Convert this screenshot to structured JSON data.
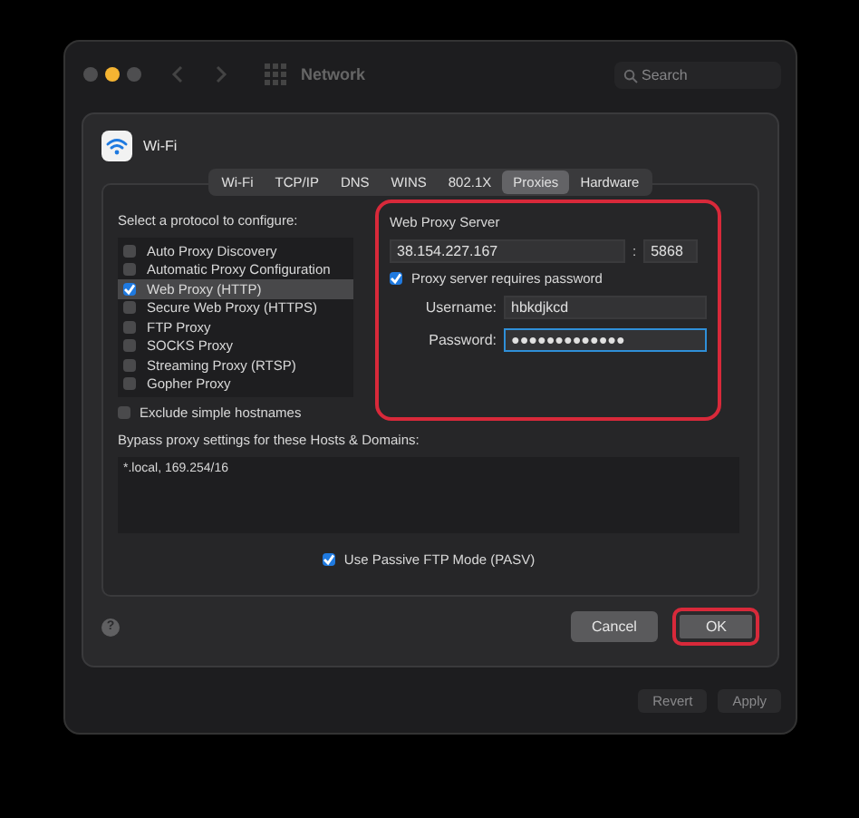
{
  "window": {
    "title": "Network",
    "search": {
      "placeholder": "Search"
    }
  },
  "sheet": {
    "service": "Wi-Fi",
    "tabs": [
      {
        "label": "Wi-Fi",
        "selected": false
      },
      {
        "label": "TCP/IP",
        "selected": false
      },
      {
        "label": "DNS",
        "selected": false
      },
      {
        "label": "WINS",
        "selected": false
      },
      {
        "label": "802.1X",
        "selected": false
      },
      {
        "label": "Proxies",
        "selected": true
      },
      {
        "label": "Hardware",
        "selected": false
      }
    ],
    "protocol_prompt": "Select a protocol to configure:",
    "protocols": [
      {
        "label": "Auto Proxy Discovery",
        "checked": false,
        "selected": false
      },
      {
        "label": "Automatic Proxy Configuration",
        "checked": false,
        "selected": false
      },
      {
        "label": "Web Proxy (HTTP)",
        "checked": true,
        "selected": true
      },
      {
        "label": "Secure Web Proxy (HTTPS)",
        "checked": false,
        "selected": false
      },
      {
        "label": "FTP Proxy",
        "checked": false,
        "selected": false
      },
      {
        "label": "SOCKS Proxy",
        "checked": false,
        "selected": false
      },
      {
        "label": "Streaming Proxy (RTSP)",
        "checked": false,
        "selected": false
      },
      {
        "label": "Gopher Proxy",
        "checked": false,
        "selected": false
      }
    ],
    "exclude_simple_hostnames": {
      "label": "Exclude simple hostnames",
      "checked": false
    },
    "proxy_server": {
      "title": "Web Proxy Server",
      "highlighted": true,
      "host": "38.154.227.167",
      "separator": ":",
      "port": "5868",
      "requires_password": {
        "label": "Proxy server requires password",
        "checked": true
      },
      "username": {
        "label": "Username:",
        "value": "hbkdjkcd"
      },
      "password": {
        "label": "Password:",
        "value": "●●●●●●●●●●●●●",
        "focused": true
      }
    },
    "bypass": {
      "label": "Bypass proxy settings for these Hosts & Domains:",
      "value": "*.local, 169.254/16"
    },
    "passive_ftp": {
      "label": "Use Passive FTP Mode (PASV)",
      "checked": true
    },
    "help": "?",
    "buttons": [
      {
        "label": "Cancel",
        "kind": "secondary",
        "highlighted": false
      },
      {
        "label": "OK",
        "kind": "primary",
        "highlighted": true
      }
    ]
  },
  "footer_buttons": [
    {
      "label": "Revert",
      "disabled": true
    },
    {
      "label": "Apply",
      "disabled": true
    }
  ]
}
